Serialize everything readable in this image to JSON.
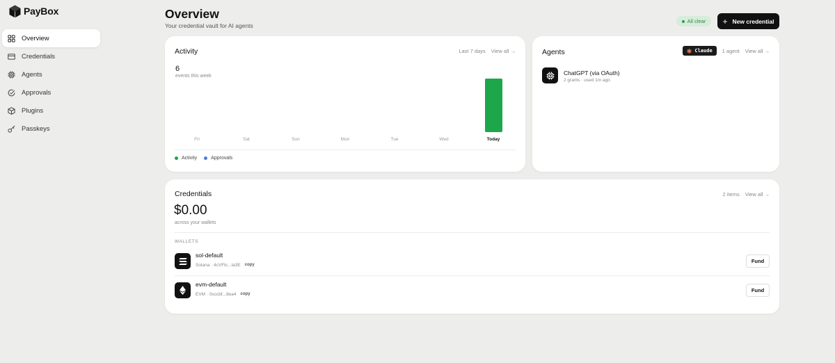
{
  "brand": {
    "name": "PayBox"
  },
  "sidebar": {
    "items": [
      {
        "label": "Overview",
        "icon": "grid-icon",
        "active": true
      },
      {
        "label": "Credentials",
        "icon": "card-icon"
      },
      {
        "label": "Agents",
        "icon": "chip-icon"
      },
      {
        "label": "Approvals",
        "icon": "check-circle-icon"
      },
      {
        "label": "Plugins",
        "icon": "cube-icon"
      },
      {
        "label": "Passkeys",
        "icon": "key-icon"
      }
    ]
  },
  "header": {
    "title": "Overview",
    "subtitle": "Your credential vault for AI agents",
    "status": "All clear",
    "new_button": "New credential"
  },
  "activity": {
    "title": "Activity",
    "range": "Last 7 days",
    "view_all": "View all →",
    "count": "6",
    "count_label": "events this week",
    "days": [
      "Fri",
      "Sat",
      "Sun",
      "Mon",
      "Tue",
      "Wed",
      "Today"
    ],
    "legend": [
      {
        "label": "Activity",
        "color": "#1ea64b"
      },
      {
        "label": "Approvals",
        "color": "#4a7fd6"
      }
    ]
  },
  "chart_data": {
    "type": "bar",
    "categories": [
      "Fri",
      "Sat",
      "Sun",
      "Mon",
      "Tue",
      "Wed",
      "Today"
    ],
    "series": [
      {
        "name": "Activity",
        "values": [
          0,
          0,
          0,
          0,
          0,
          0,
          6
        ]
      },
      {
        "name": "Approvals",
        "values": [
          0,
          0,
          0,
          0,
          0,
          0,
          0
        ]
      }
    ],
    "colors": {
      "Activity": "#1ea64b",
      "Approvals": "#4a7fd6"
    }
  },
  "agents": {
    "title": "Agents",
    "chip": "Claude",
    "count": "1 agent",
    "view_all": "View all →",
    "list": [
      {
        "name": "ChatGPT (via OAuth)",
        "meta": "2 grants · used 1m ago"
      }
    ]
  },
  "credentials": {
    "title": "Credentials",
    "count": "2 items",
    "view_all": "View all →",
    "balance": "$0.00",
    "balance_label": "across your wallets",
    "section": "WALLETS",
    "wallets": [
      {
        "name": "sol-default",
        "addr": "Solana · 4cVFtc...la3E",
        "copy": "copy",
        "fund": "Fund",
        "chain_icon": "solana-icon"
      },
      {
        "name": "evm-default",
        "addr": "EVM · 0xccbf...8ea4",
        "copy": "copy",
        "fund": "Fund",
        "chain_icon": "ethereum-icon"
      }
    ]
  }
}
